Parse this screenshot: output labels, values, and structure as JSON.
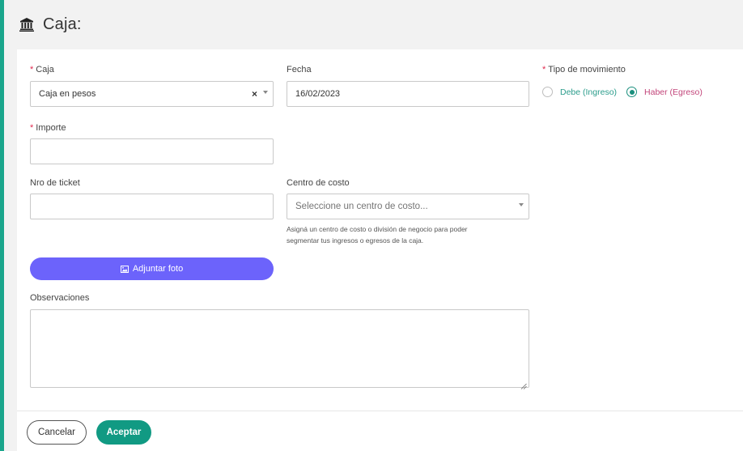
{
  "header": {
    "title": "Caja:",
    "icon": "bank-icon"
  },
  "form": {
    "caja": {
      "label": "Caja",
      "value": "Caja en pesos",
      "clear_symbol": "×"
    },
    "fecha": {
      "label": "Fecha",
      "value": "16/02/2023"
    },
    "tipo_movimiento": {
      "label": "Tipo de movimiento",
      "options": [
        {
          "label": "Debe (Ingreso)",
          "checked": false
        },
        {
          "label": "Haber (Egreso)",
          "checked": true
        }
      ]
    },
    "importe": {
      "label": "Importe",
      "value": ""
    },
    "nro_ticket": {
      "label": "Nro de ticket",
      "value": ""
    },
    "centro_costo": {
      "label": "Centro de costo",
      "placeholder": "Seleccione un centro de costo...",
      "help_line1": "Asigná un centro de costo o división de negocio para poder",
      "help_line2": "segmentar tus ingresos o egresos de la caja."
    },
    "adjuntar_foto": {
      "label": "Adjuntar foto",
      "icon": "image-icon"
    },
    "observaciones": {
      "label": "Observaciones",
      "value": ""
    },
    "required_mark": "*"
  },
  "footer": {
    "cancel_label": "Cancelar",
    "accept_label": "Aceptar"
  },
  "colors": {
    "accent": "#1aa68c",
    "primary_button": "#6c63fb",
    "accept_button": "#119a83",
    "debe_text": "#2a9c8b",
    "haber_text": "#c2457a",
    "required": "#e0294e"
  }
}
